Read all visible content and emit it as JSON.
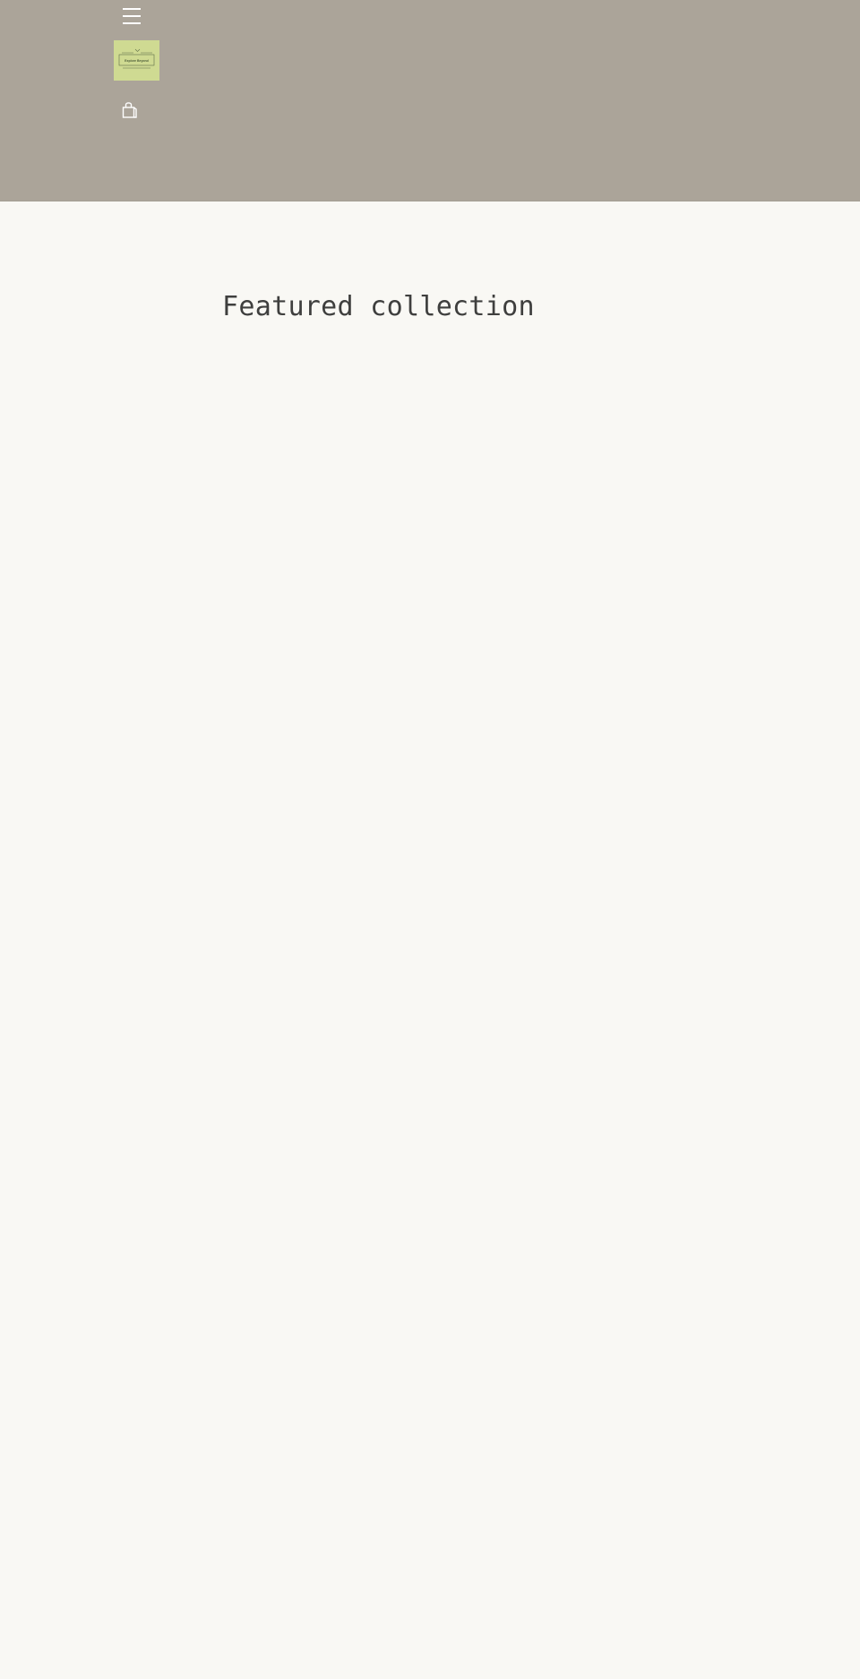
{
  "header": {
    "menu_icon": "hamburger-menu-icon",
    "logo": {
      "text": "Explore Beyond",
      "background_color": "#cfda92",
      "text_color": "#4e5e3a"
    },
    "cart_icon": "shopping-bag-icon",
    "background_color": "#aba499"
  },
  "main": {
    "featured_collection_title": "Featured collection",
    "background_color": "#f9f8f4",
    "text_color": "#3f3f3e"
  }
}
